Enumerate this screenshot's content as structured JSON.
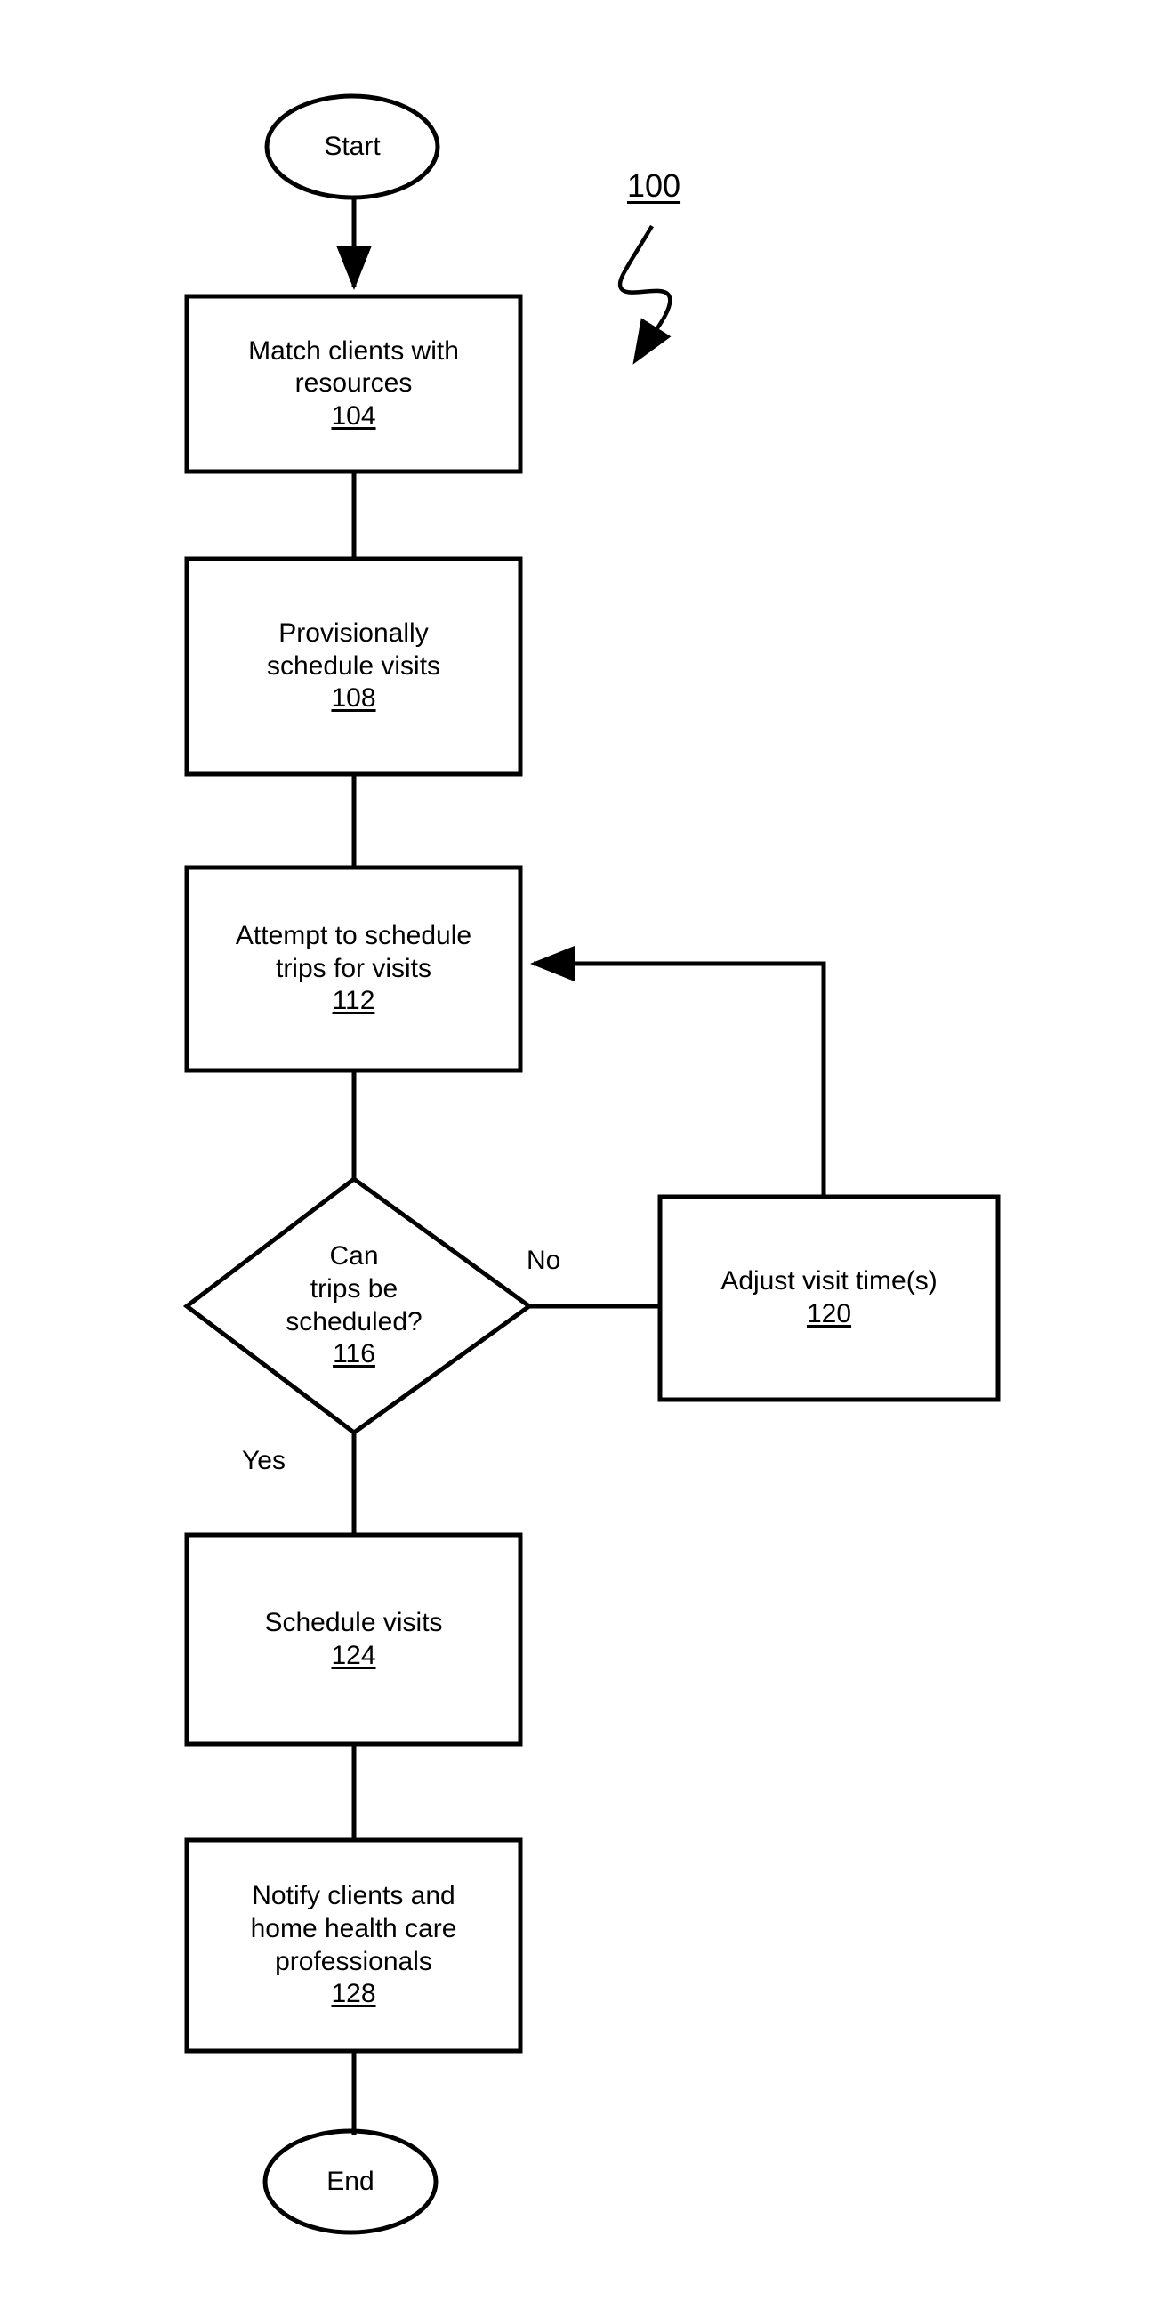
{
  "figure": {
    "reference_numeral": "100",
    "stroke_color": "#000000",
    "fill_color": "#ffffff",
    "background_color": "#ffffff"
  },
  "nodes": [
    {
      "id": "start",
      "shape": "ellipse",
      "label": "Start",
      "ref": ""
    },
    {
      "id": "match",
      "shape": "process",
      "line1": "Match clients with",
      "line2": "resources",
      "line3": "",
      "ref": "104"
    },
    {
      "id": "provisional",
      "shape": "process",
      "line1": "Provisionally",
      "line2": "schedule visits",
      "line3": "",
      "ref": "108"
    },
    {
      "id": "attempt",
      "shape": "process",
      "line1": "Attempt to schedule",
      "line2": "trips for visits",
      "line3": "",
      "ref": "112"
    },
    {
      "id": "decision",
      "shape": "decision",
      "line1": "Can",
      "line2": "trips be",
      "line3": "scheduled?",
      "ref": "116"
    },
    {
      "id": "adjust",
      "shape": "process",
      "line1": "Adjust visit time(s)",
      "line2": "",
      "line3": "",
      "ref": "120"
    },
    {
      "id": "schedule",
      "shape": "process",
      "line1": "Schedule visits",
      "line2": "",
      "line3": "",
      "ref": "124"
    },
    {
      "id": "notify",
      "shape": "process",
      "line1": "Notify clients and",
      "line2": "home health care",
      "line3": "professionals",
      "ref": "128"
    },
    {
      "id": "end",
      "shape": "ellipse",
      "label": "End",
      "ref": ""
    }
  ],
  "edge_labels": {
    "no": "No",
    "yes": "Yes"
  }
}
